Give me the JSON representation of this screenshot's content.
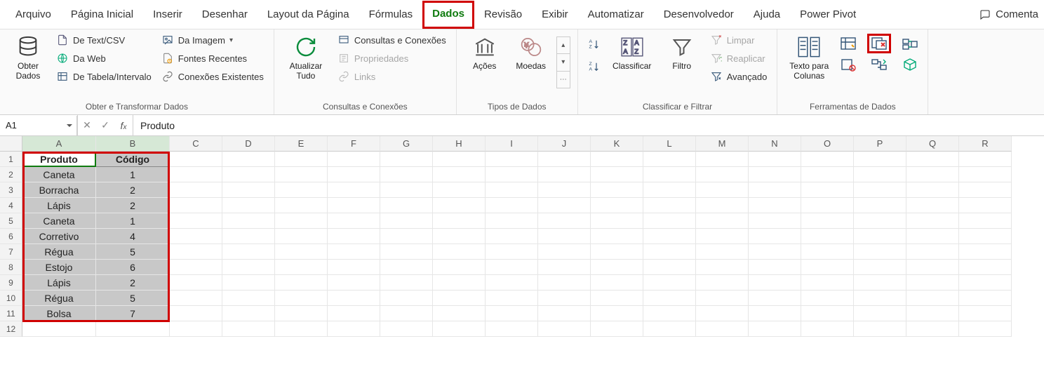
{
  "tabs": {
    "arquivo": "Arquivo",
    "pagina_inicial": "Página Inicial",
    "inserir": "Inserir",
    "desenhar": "Desenhar",
    "layout": "Layout da Página",
    "formulas": "Fórmulas",
    "dados": "Dados",
    "revisao": "Revisão",
    "exibir": "Exibir",
    "automatizar": "Automatizar",
    "desenvolvedor": "Desenvolvedor",
    "ajuda": "Ajuda",
    "power_pivot": "Power Pivot",
    "comenta": "Comenta"
  },
  "ribbon": {
    "obter": {
      "obter_dados": "Obter\nDados",
      "text_csv": "De Text/CSV",
      "da_web": "Da Web",
      "tabela_intervalo": "De Tabela/Intervalo",
      "da_imagem": "Da Imagem",
      "fontes_recentes": "Fontes Recentes",
      "conexoes_existentes": "Conexões Existentes",
      "label": "Obter e Transformar Dados"
    },
    "conexoes": {
      "atualizar_tudo": "Atualizar\nTudo",
      "consultas_e_conexoes": "Consultas e Conexões",
      "propriedades": "Propriedades",
      "links": "Links",
      "label": "Consultas e Conexões"
    },
    "tipos": {
      "acoes": "Ações",
      "moedas": "Moedas",
      "label": "Tipos de Dados"
    },
    "classificar": {
      "classificar": "Classificar",
      "filtro": "Filtro",
      "limpar": "Limpar",
      "reaplicar": "Reaplicar",
      "avancado": "Avançado",
      "label": "Classificar e Filtrar"
    },
    "ferramentas": {
      "texto_para_colunas": "Texto para\nColunas",
      "label": "Ferramentas de Dados"
    }
  },
  "namebox": "A1",
  "fx_content": "Produto",
  "columns": [
    "A",
    "B",
    "C",
    "D",
    "E",
    "F",
    "G",
    "H",
    "I",
    "J",
    "K",
    "L",
    "M",
    "N",
    "O",
    "P",
    "Q",
    "R"
  ],
  "rows": [
    "1",
    "2",
    "3",
    "4",
    "5",
    "6",
    "7",
    "8",
    "9",
    "10",
    "11",
    "12"
  ],
  "table": {
    "headers": {
      "produto": "Produto",
      "codigo": "Código"
    },
    "data": [
      {
        "produto": "Caneta",
        "codigo": "1"
      },
      {
        "produto": "Borracha",
        "codigo": "2"
      },
      {
        "produto": "Lápis",
        "codigo": "2"
      },
      {
        "produto": "Caneta",
        "codigo": "1"
      },
      {
        "produto": "Corretivo",
        "codigo": "4"
      },
      {
        "produto": "Régua",
        "codigo": "5"
      },
      {
        "produto": "Estojo",
        "codigo": "6"
      },
      {
        "produto": "Lápis",
        "codigo": "2"
      },
      {
        "produto": "Régua",
        "codigo": "5"
      },
      {
        "produto": "Bolsa",
        "codigo": "7"
      }
    ]
  }
}
